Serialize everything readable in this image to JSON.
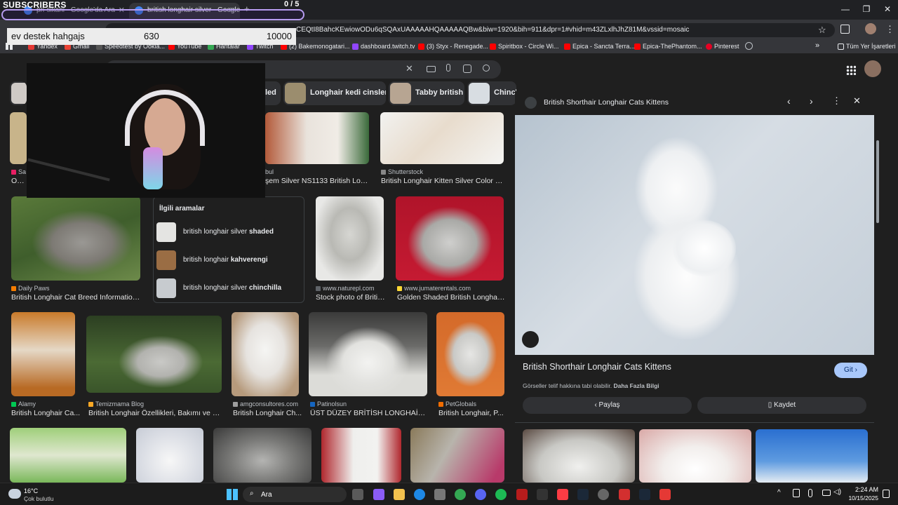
{
  "browser": {
    "tabs": [
      {
        "label": "pri-sikani - Google'da Ara"
      },
      {
        "label": "british longhair silver - Google"
      }
    ],
    "new_tab": "+",
    "url": "CEQtI8BahcKEwiowODu6qSQAxUAAAAAHQAAAAAQBw&biw=1920&bih=911&dpr=1#vhid=m43ZLxlhJhZ81M&vssid=mosaic",
    "bookmarks": [
      {
        "label": "Yandex",
        "color": "#e53935"
      },
      {
        "label": "Gmail",
        "color": "#ea4335"
      },
      {
        "label": "Speedtest by Ookla...",
        "color": "#141526"
      },
      {
        "label": "YouTube",
        "color": "#ff0000"
      },
      {
        "label": "Haritalar",
        "color": "#34a853"
      },
      {
        "label": "Twitch",
        "color": "#9146ff"
      },
      {
        "label": "(2) Bakemonogatari...",
        "color": "#ff0000"
      },
      {
        "label": "dashboard.twitch.tv",
        "color": "#9146ff"
      },
      {
        "label": "(3) Styx - Renegade...",
        "color": "#ff0000"
      },
      {
        "label": "Spiritbox - Circle Wi...",
        "color": "#ff0000"
      },
      {
        "label": "Epica - Sancta Terra...",
        "color": "#ff0000"
      },
      {
        "label": "Epica-ThePhantom...",
        "color": "#ff0000"
      },
      {
        "label": "Pinterest",
        "color": "#e60023"
      }
    ],
    "all_bookmarks": "Tüm Yer İşaretleri"
  },
  "stream_overlay": {
    "title": "SUBSCRIBERS",
    "sub_count": "0 / 5",
    "donation_name": "ev destek hahgajs",
    "donation_current": "630",
    "donation_goal": "10000"
  },
  "chips": [
    {
      "label": "led"
    },
    {
      "label": "Longhair kedi cinsleri"
    },
    {
      "label": "Tabby british"
    },
    {
      "label": "Chinch"
    }
  ],
  "results": [
    {
      "source": "Sa",
      "title": "OYUI"
    },
    {
      "source": "bul",
      "title": "şem Silver NS1133 British Long..."
    },
    {
      "source": "Shutterstock",
      "title": "British Longhair Kitten Silver Color On..."
    },
    {
      "source": "Daily Paws",
      "title": "British Longhair Cat Breed Information & ..."
    },
    {
      "source": "www.naturepl.com",
      "title": "Stock photo of Britis..."
    },
    {
      "source": "www.jumaterentals.com",
      "title": "Golden Shaded British Longhair ..."
    },
    {
      "source": "Alamy",
      "title": "British Longhair Ca..."
    },
    {
      "source": "Temizmama Blog",
      "title": "British Longhair Özellikleri, Bakımı ve İsi..."
    },
    {
      "source": "amgconsultores.com",
      "title": "British Longhair Ch..."
    },
    {
      "source": "Patinolsun",
      "title": "ÜST DÜZEY BRİTİSH LONGHAİR ..."
    },
    {
      "source": "PetGlobals",
      "title": "British Longhair, P..."
    }
  ],
  "related": {
    "heading": "İlgili aramalar",
    "items": [
      {
        "prefix": "british longhair silver ",
        "bold": "shaded"
      },
      {
        "prefix": "british longhair ",
        "bold": "kahverengi"
      },
      {
        "prefix": "british longhair silver ",
        "bold": "chinchilla"
      }
    ]
  },
  "panel": {
    "site": "British Shorthair Longhair Cats Kittens",
    "title": "British Shorthair Longhair Cats Kittens",
    "visit": "Git",
    "copyright": "Görseller telif hakkına tabi olabilir.",
    "more_info": "Daha Fazla Bilgi",
    "share": "Paylaş",
    "save": "Kaydet"
  },
  "taskbar": {
    "weather_temp": "16°C",
    "weather_desc": "Çok bulutlu",
    "search": "Ara",
    "time": "2:24 AM",
    "date": "10/15/2025"
  }
}
